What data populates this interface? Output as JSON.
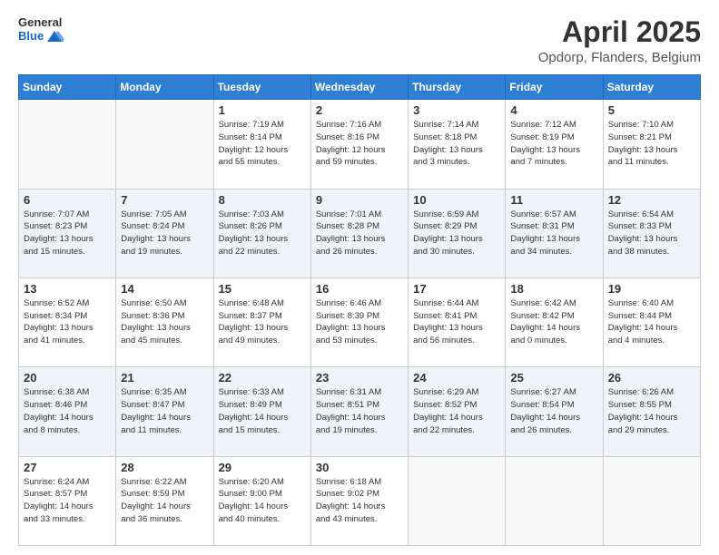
{
  "header": {
    "logo_general": "General",
    "logo_blue": "Blue",
    "title": "April 2025",
    "subtitle": "Opdorp, Flanders, Belgium"
  },
  "weekdays": [
    "Sunday",
    "Monday",
    "Tuesday",
    "Wednesday",
    "Thursday",
    "Friday",
    "Saturday"
  ],
  "weeks": [
    [
      {
        "day": "",
        "info": ""
      },
      {
        "day": "",
        "info": ""
      },
      {
        "day": "1",
        "info": "Sunrise: 7:19 AM\nSunset: 8:14 PM\nDaylight: 12 hours\nand 55 minutes."
      },
      {
        "day": "2",
        "info": "Sunrise: 7:16 AM\nSunset: 8:16 PM\nDaylight: 12 hours\nand 59 minutes."
      },
      {
        "day": "3",
        "info": "Sunrise: 7:14 AM\nSunset: 8:18 PM\nDaylight: 13 hours\nand 3 minutes."
      },
      {
        "day": "4",
        "info": "Sunrise: 7:12 AM\nSunset: 8:19 PM\nDaylight: 13 hours\nand 7 minutes."
      },
      {
        "day": "5",
        "info": "Sunrise: 7:10 AM\nSunset: 8:21 PM\nDaylight: 13 hours\nand 11 minutes."
      }
    ],
    [
      {
        "day": "6",
        "info": "Sunrise: 7:07 AM\nSunset: 8:23 PM\nDaylight: 13 hours\nand 15 minutes."
      },
      {
        "day": "7",
        "info": "Sunrise: 7:05 AM\nSunset: 8:24 PM\nDaylight: 13 hours\nand 19 minutes."
      },
      {
        "day": "8",
        "info": "Sunrise: 7:03 AM\nSunset: 8:26 PM\nDaylight: 13 hours\nand 22 minutes."
      },
      {
        "day": "9",
        "info": "Sunrise: 7:01 AM\nSunset: 8:28 PM\nDaylight: 13 hours\nand 26 minutes."
      },
      {
        "day": "10",
        "info": "Sunrise: 6:59 AM\nSunset: 8:29 PM\nDaylight: 13 hours\nand 30 minutes."
      },
      {
        "day": "11",
        "info": "Sunrise: 6:57 AM\nSunset: 8:31 PM\nDaylight: 13 hours\nand 34 minutes."
      },
      {
        "day": "12",
        "info": "Sunrise: 6:54 AM\nSunset: 8:33 PM\nDaylight: 13 hours\nand 38 minutes."
      }
    ],
    [
      {
        "day": "13",
        "info": "Sunrise: 6:52 AM\nSunset: 8:34 PM\nDaylight: 13 hours\nand 41 minutes."
      },
      {
        "day": "14",
        "info": "Sunrise: 6:50 AM\nSunset: 8:36 PM\nDaylight: 13 hours\nand 45 minutes."
      },
      {
        "day": "15",
        "info": "Sunrise: 6:48 AM\nSunset: 8:37 PM\nDaylight: 13 hours\nand 49 minutes."
      },
      {
        "day": "16",
        "info": "Sunrise: 6:46 AM\nSunset: 8:39 PM\nDaylight: 13 hours\nand 53 minutes."
      },
      {
        "day": "17",
        "info": "Sunrise: 6:44 AM\nSunset: 8:41 PM\nDaylight: 13 hours\nand 56 minutes."
      },
      {
        "day": "18",
        "info": "Sunrise: 6:42 AM\nSunset: 8:42 PM\nDaylight: 14 hours\nand 0 minutes."
      },
      {
        "day": "19",
        "info": "Sunrise: 6:40 AM\nSunset: 8:44 PM\nDaylight: 14 hours\nand 4 minutes."
      }
    ],
    [
      {
        "day": "20",
        "info": "Sunrise: 6:38 AM\nSunset: 8:46 PM\nDaylight: 14 hours\nand 8 minutes."
      },
      {
        "day": "21",
        "info": "Sunrise: 6:35 AM\nSunset: 8:47 PM\nDaylight: 14 hours\nand 11 minutes."
      },
      {
        "day": "22",
        "info": "Sunrise: 6:33 AM\nSunset: 8:49 PM\nDaylight: 14 hours\nand 15 minutes."
      },
      {
        "day": "23",
        "info": "Sunrise: 6:31 AM\nSunset: 8:51 PM\nDaylight: 14 hours\nand 19 minutes."
      },
      {
        "day": "24",
        "info": "Sunrise: 6:29 AM\nSunset: 8:52 PM\nDaylight: 14 hours\nand 22 minutes."
      },
      {
        "day": "25",
        "info": "Sunrise: 6:27 AM\nSunset: 8:54 PM\nDaylight: 14 hours\nand 26 minutes."
      },
      {
        "day": "26",
        "info": "Sunrise: 6:26 AM\nSunset: 8:55 PM\nDaylight: 14 hours\nand 29 minutes."
      }
    ],
    [
      {
        "day": "27",
        "info": "Sunrise: 6:24 AM\nSunset: 8:57 PM\nDaylight: 14 hours\nand 33 minutes."
      },
      {
        "day": "28",
        "info": "Sunrise: 6:22 AM\nSunset: 8:59 PM\nDaylight: 14 hours\nand 36 minutes."
      },
      {
        "day": "29",
        "info": "Sunrise: 6:20 AM\nSunset: 9:00 PM\nDaylight: 14 hours\nand 40 minutes."
      },
      {
        "day": "30",
        "info": "Sunrise: 6:18 AM\nSunset: 9:02 PM\nDaylight: 14 hours\nand 43 minutes."
      },
      {
        "day": "",
        "info": ""
      },
      {
        "day": "",
        "info": ""
      },
      {
        "day": "",
        "info": ""
      }
    ]
  ]
}
